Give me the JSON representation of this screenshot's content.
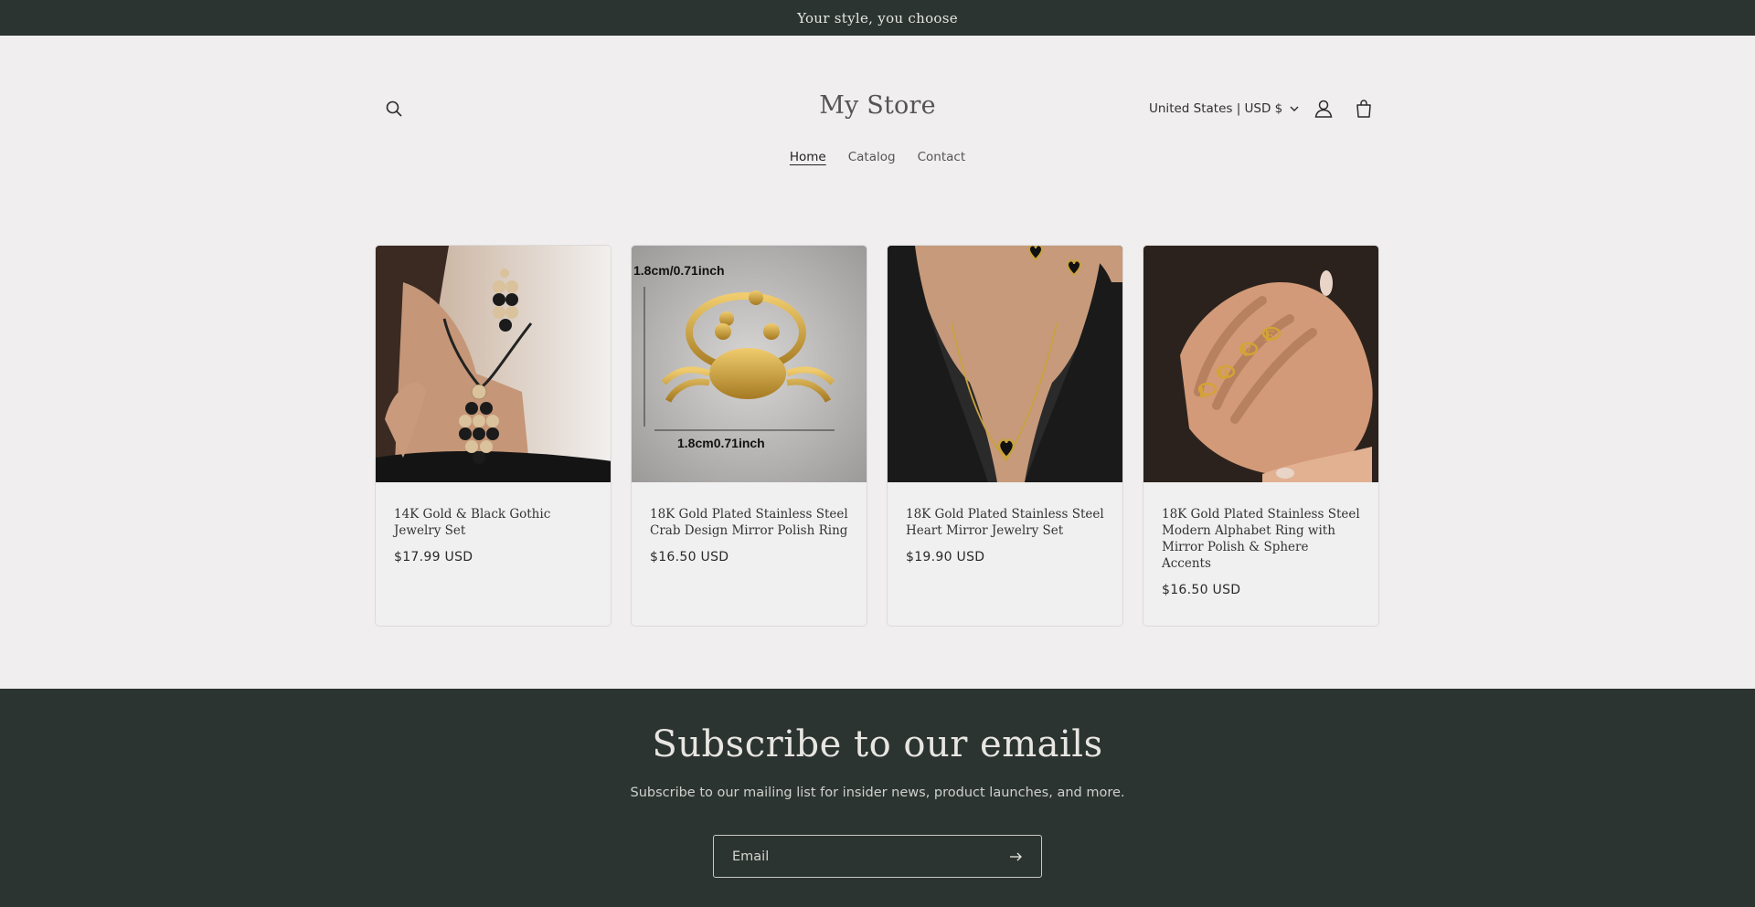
{
  "announcement": "Your style, you choose",
  "header": {
    "logo": "My Store",
    "currency": "United States | USD $"
  },
  "nav": [
    {
      "label": "Home",
      "active": true
    },
    {
      "label": "Catalog",
      "active": false
    },
    {
      "label": "Contact",
      "active": false
    }
  ],
  "products": [
    {
      "title": "14K Gold & Black Gothic Jewelry Set",
      "price": "$17.99 USD"
    },
    {
      "title": "18K Gold Plated Stainless Steel Crab Design Mirror Polish Ring",
      "price": "$16.50 USD",
      "image_labels": [
        "1.8cm/0.71inch",
        "1.8cm0.71inch"
      ]
    },
    {
      "title": "18K Gold Plated Stainless Steel Heart Mirror Jewelry Set",
      "price": "$19.90 USD"
    },
    {
      "title": "18K Gold Plated Stainless Steel Modern Alphabet Ring with Mirror Polish & Sphere Accents",
      "price": "$16.50 USD"
    }
  ],
  "newsletter": {
    "heading": "Subscribe to our emails",
    "text": "Subscribe to our mailing list for insider news, product launches, and more.",
    "placeholder": "Email"
  },
  "icons": [
    "search-icon",
    "chevron-down-icon",
    "user-icon",
    "cart-icon",
    "arrow-right-icon"
  ],
  "colors": {
    "page_bg": "#f0eeee",
    "dark_band": "#2c3431",
    "gold": "#c89b3c"
  }
}
